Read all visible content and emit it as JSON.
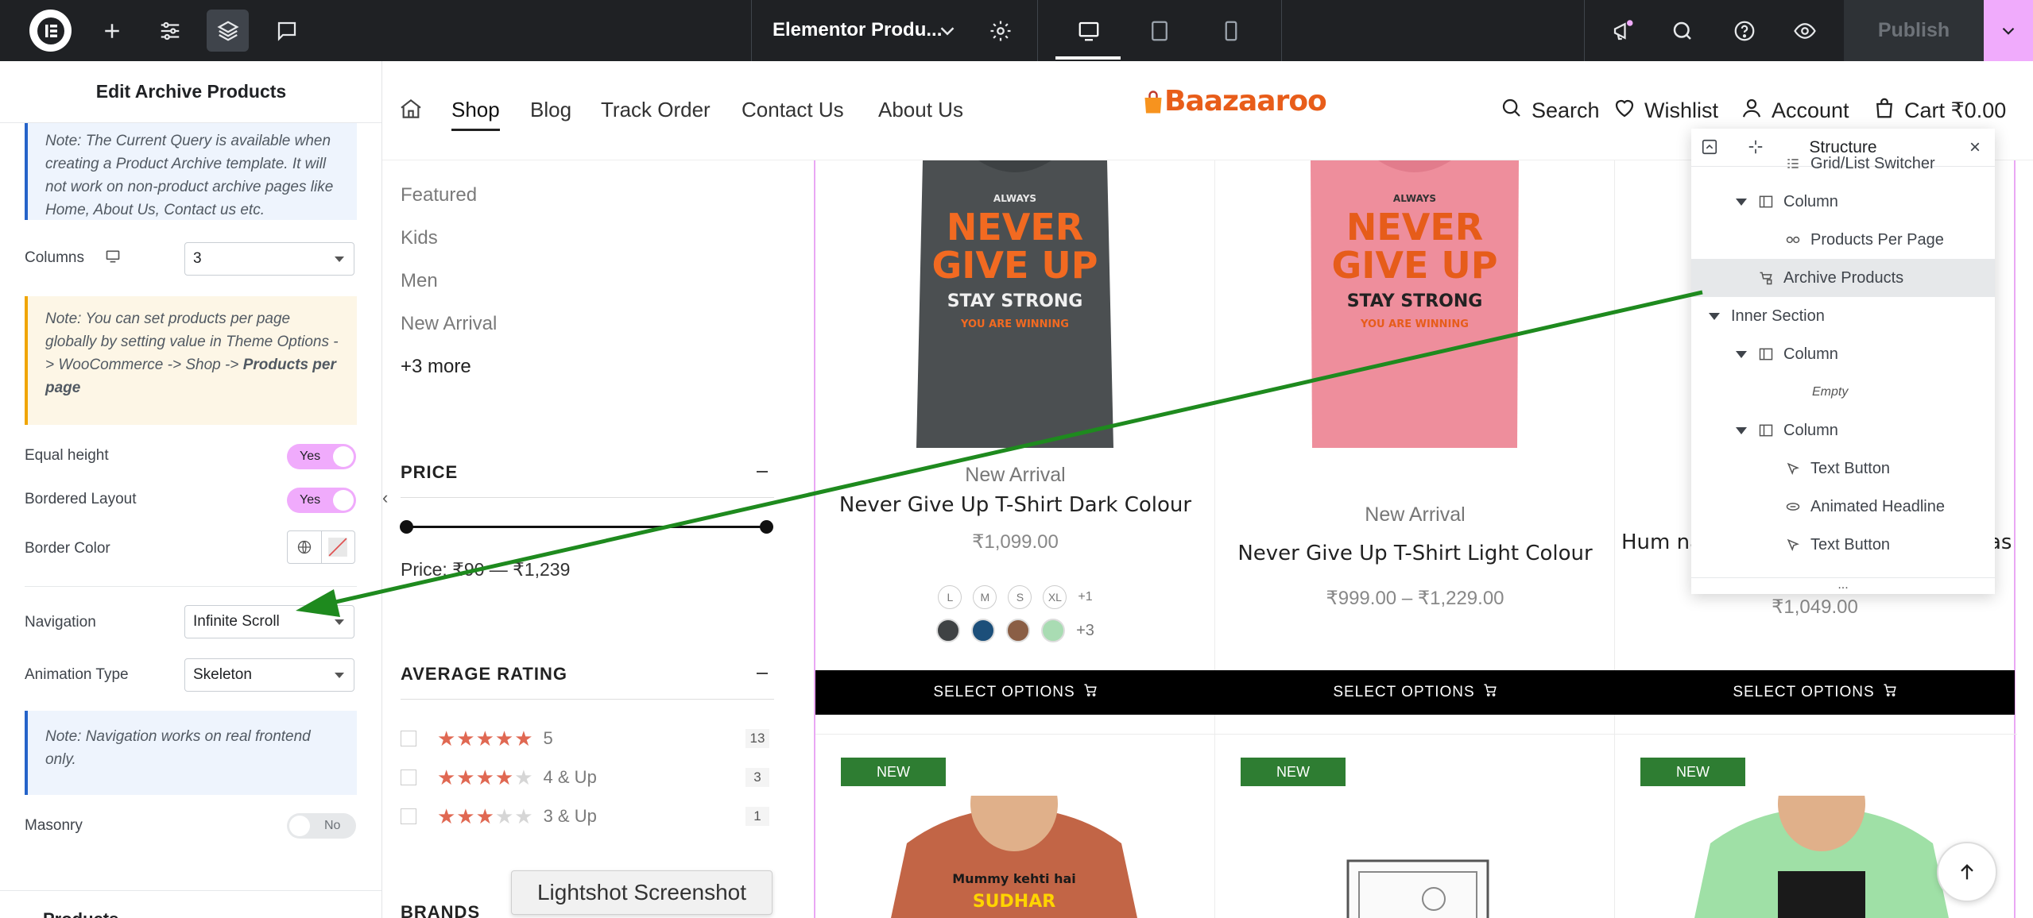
{
  "topbar": {
    "document_title": "Elementor Produ...",
    "publish_label": "Publish"
  },
  "panel": {
    "title": "Edit Archive Products",
    "note_query": "Note: The Current Query is available when creating a Product Archive template. It will not work on non-product archive pages like Home, About Us, Contact us etc.",
    "columns_label": "Columns",
    "columns_value": "3",
    "note_per_page_pre": "Note: You can set products per page globally by setting value in Theme Options -> WooCommerce -> Shop -> ",
    "note_per_page_bold": "Products per page",
    "equal_height_label": "Equal height",
    "equal_height_value": "Yes",
    "bordered_label": "Bordered Layout",
    "bordered_value": "Yes",
    "border_color_label": "Border Color",
    "navigation_label": "Navigation",
    "navigation_value": "Infinite Scroll",
    "animation_label": "Animation Type",
    "animation_value": "Skeleton",
    "note_navigation": "Note: Navigation works on real frontend only.",
    "masonry_label": "Masonry",
    "masonry_value": "No",
    "section_label": "Products"
  },
  "header": {
    "nav": [
      "Shop",
      "Blog",
      "Track Order",
      "Contact Us",
      "About Us"
    ],
    "brand": "Baazaaroo",
    "search": "Search",
    "wishlist": "Wishlist",
    "account": "Account",
    "cart": "Cart ₹0.00"
  },
  "sidebar": {
    "categories": [
      "Featured",
      "Kids",
      "Men",
      "New Arrival"
    ],
    "more": "+3 more",
    "price_title": "PRICE",
    "price_text": "Price: ₹90 — ₹1,239",
    "rating_title": "AVERAGE RATING",
    "ratings": [
      {
        "label": "5",
        "count": "13",
        "stars": 5
      },
      {
        "label": "4 & Up",
        "count": "3",
        "stars": 4
      },
      {
        "label": "3 & Up",
        "count": "1",
        "stars": 3
      }
    ],
    "brands_title": "BRANDS"
  },
  "products": [
    {
      "category": "New Arrival",
      "title": "Never Give Up T-Shirt Dark Colour",
      "price": "₹1,099.00",
      "sizes": [
        "L",
        "M",
        "S",
        "XL"
      ],
      "sizes_more": "+1",
      "swatches_more": "+3",
      "button": "SELECT OPTIONS",
      "shirt_color": "#4b4f51"
    },
    {
      "category": "New Arrival",
      "title": "Never Give Up T-Shirt Light Colour",
      "price": "₹999.00 – ₹1,229.00",
      "button": "SELECT OPTIONS",
      "shirt_color": "#ee8e9c"
    },
    {
      "title": "Hum na",
      "title_tail": "as",
      "price": "₹1,049.00",
      "button": "SELECT OPTIONS",
      "shirt_color": "#7e4a9e"
    }
  ],
  "row2": {
    "badge": "NEW",
    "tshirt_text": "Mummy kehti hai",
    "tshirt_text2": "SUDHAR"
  },
  "shirt_print": {
    "line1": "ALWAYS",
    "line2": "NEVER",
    "line3": "GIVE UP",
    "line4": "STAY STRONG",
    "line5": "YOU ARE WINNING"
  },
  "structure": {
    "title": "Structure",
    "items": [
      {
        "label": "Grid/List Switcher",
        "indent": 2,
        "icon": "switcher"
      },
      {
        "label": "Column",
        "indent": 1,
        "icon": "column",
        "caret": true
      },
      {
        "label": "Products Per Page",
        "indent": 2,
        "icon": "products-per-page"
      },
      {
        "label": "Archive Products",
        "indent": 1,
        "icon": "archive",
        "active": true
      },
      {
        "label": "Inner Section",
        "indent": 0,
        "caret": true
      },
      {
        "label": "Column",
        "indent": 1,
        "icon": "column",
        "caret": true
      },
      {
        "label": "Empty",
        "indent": 3,
        "empty": true
      },
      {
        "label": "Column",
        "indent": 1,
        "icon": "column",
        "caret": true
      },
      {
        "label": "Text Button",
        "indent": 2,
        "icon": "text-button"
      },
      {
        "label": "Animated Headline",
        "indent": 2,
        "icon": "headline"
      },
      {
        "label": "Text Button",
        "indent": 2,
        "icon": "text-button"
      }
    ],
    "more": "..."
  },
  "lightshot": "Lightshot Screenshot",
  "colors": {
    "accent": "#f0abfc",
    "dark": "#1f2124",
    "arrow": "#1e8a1e",
    "badge": "#2e7d32",
    "rating": "#e06852"
  }
}
